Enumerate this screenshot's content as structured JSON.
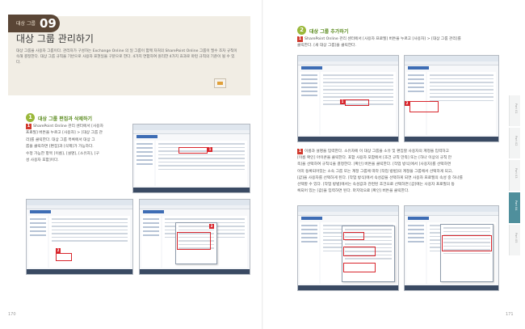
{
  "chapter": {
    "label": "대상 그룹",
    "number": "09"
  },
  "page_title": "대상 그룹 관리하기",
  "intro": "대상 그룹을 사용자 그룹이다. 관리자가 구성하는 Exchange Online 의 일 그룹이 함께 자처의 SharePoint Online 그룹이 필수 조차 규칙이 속해 결정한다. 대상 그룹 규칙을 기반으로 사용자 표현일을 구분으로 한다. 4가지 연합하여 원리한 4가지 효과로 마련 규칙의 기준이 될 수 있다.",
  "step1": {
    "number": "1",
    "title": "대상 그룹 편집과 삭제하기",
    "line1": "SharePoint Online 관리 센터에서 [사용자",
    "line2": "프로필] 버튼을 누르고 [사용자] > [대상 그룹 관",
    "line3": "리]를 클릭한다. 대상 그룹 목록에서 대상 그",
    "line4": "룹을 클릭하면 [편집]과 [삭제]가 가능하다.",
    "line5": "수정 가능한 항목 [이름], [설명], [소유자], [구",
    "line6": "성 사용자 포함]이다.",
    "marker_a": "1",
    "marker_b": "2",
    "marker_c": "3"
  },
  "step2": {
    "number": "2",
    "title": "대상 그룹 추가하기",
    "line1": "SharePoint Online 관리 센터에서 [사용자 프로필] 버튼을 누르고 [사용자] > [대상 그룹 관리]를",
    "line2": "클릭한다. [새 대상 그룹]을 클릭한다.",
    "marker_a": "1",
    "marker_b": "2"
  },
  "step3": {
    "line1": "이름과 설명을 입력한다. 소유자에 이 대상 그룹을 소유 및 편집할 사용자의 계정을 입력하고",
    "line2": "[이름 확인] 아이콘을 클릭한다. 포함 사용자 포함에서 [조건 규칙 만족] 또는 [하나 이상의 규칙 만",
    "line3": "족]을 선택하여 규칙식을 결정한다. [확인] 버튼을 클릭한다. [작업 방식]에서 [사용자]를 선택하면",
    "line4": "이미 등록되어있는 소속 그룹 또는 계정 그룹에 따라 [작업 방법]의 계정을 그룹에서 선택하게 되고,",
    "line5": "[값]을 사용자를 선택하게 된다. [작업 방식]에서 속성값을 선택하게 되면 사용자 프로필의 속성 중 하나를",
    "line6": "선택할 수 있다. [작업 방법]에서는 속성값과 관련된 조건으로 선택하면 [값]에는 사용자 프로필의 등",
    "line7": "록되어 있는 [값]을 입력하면 된다. 마지막으로 [확인] 버튼을 클릭한다."
  },
  "screens": {
    "title_text": "SharePoint Online"
  },
  "page_numbers": {
    "left": "170",
    "right": "171"
  },
  "side_tabs": [
    "Part 01",
    "Part 02",
    "Part 03",
    "Part 04",
    "Part 05"
  ],
  "colors": {
    "accent_green": "#9ab83a",
    "marker_red": "#d13a2e",
    "chapter_brown": "#5a4636",
    "tab_active": "#4f8f9c"
  }
}
